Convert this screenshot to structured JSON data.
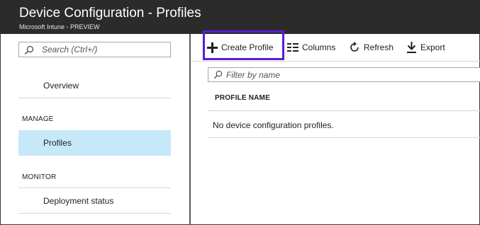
{
  "header": {
    "title": "Device Configuration - Profiles",
    "subtitle": "Microsoft Intune - PREVIEW"
  },
  "sidebar": {
    "search": {
      "placeholder": "Search (Ctrl+/)",
      "value": ""
    },
    "overview_label": "Overview",
    "sections": [
      {
        "label": "MANAGE",
        "items": [
          {
            "label": "Profiles",
            "selected": true
          }
        ]
      },
      {
        "label": "MONITOR",
        "items": [
          {
            "label": "Deployment status",
            "selected": false
          }
        ]
      }
    ]
  },
  "toolbar": {
    "create_profile_label": "Create Profile",
    "columns_label": "Columns",
    "refresh_label": "Refresh",
    "export_label": "Export"
  },
  "main": {
    "filter": {
      "placeholder": "Filter by name",
      "value": ""
    },
    "table": {
      "columns": [
        "PROFILE NAME"
      ],
      "empty_message": "No device configuration profiles."
    }
  },
  "colors": {
    "header_bg": "#2b2b2b",
    "selected_bg": "#c6e9fa",
    "highlight_border": "#5a1bd9"
  }
}
